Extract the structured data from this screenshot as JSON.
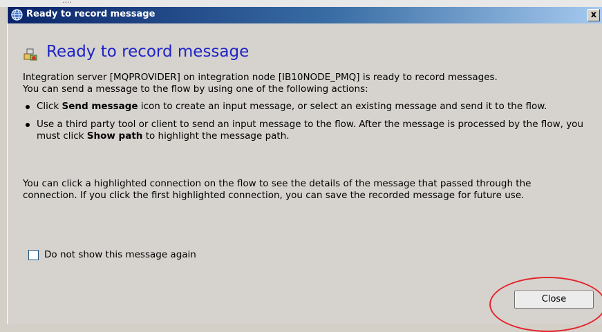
{
  "window": {
    "title": "Ready to record message",
    "close_glyph": "x"
  },
  "background_strip": {
    "text": "...."
  },
  "dialog": {
    "heading": "Ready to record message",
    "heading_icon": "record-message-icon",
    "intro_line1": "Integration server [MQPROVIDER] on integration node [IB10NODE_PMQ] is ready to record messages.",
    "intro_line2": "You can send a message to the flow by using one of the following actions:",
    "bullet1": {
      "prefix": "Click ",
      "bold": "Send message",
      "suffix": " icon to create an input message, or select an existing message and send it to the flow."
    },
    "bullet2": {
      "prefix": "Use a third party tool or client to send an input message to the flow. After the message is processed by the flow, you must click ",
      "bold": "Show path",
      "suffix": " to highlight the message path."
    },
    "para3": "You can click a highlighted connection on the flow to see the details of the message that passed through the connection. If you click the first highlighted connection, you can save the recorded message for future use.",
    "checkbox_label": "Do not show this message again",
    "checkbox_checked": false,
    "close_button": "Close"
  },
  "colors": {
    "heading": "#1f23c6",
    "titlebar_start": "#0a246a",
    "annotation": "#e3242b"
  }
}
